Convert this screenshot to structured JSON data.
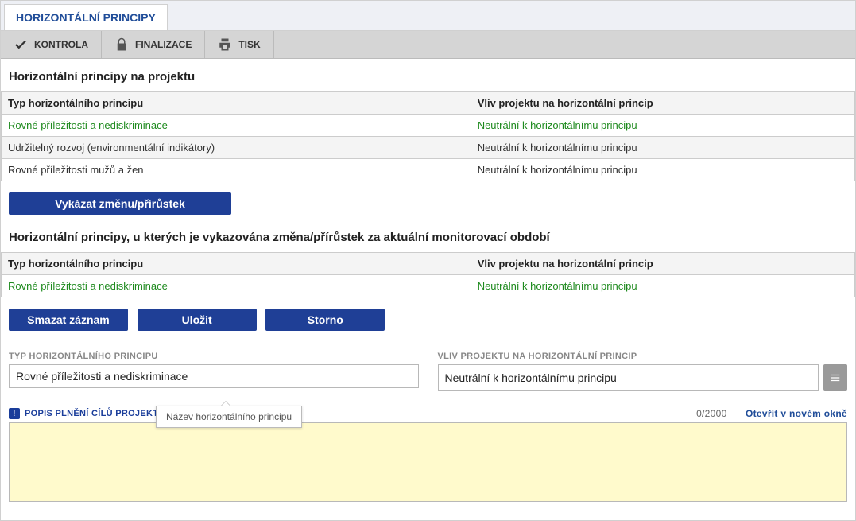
{
  "tab": "HORIZONTÁLNÍ PRINCIPY",
  "toolbar": {
    "kontrola": "KONTROLA",
    "finalizace": "FINALIZACE",
    "tisk": "TISK"
  },
  "section1_title": "Horizontální principy na projektu",
  "cols": {
    "typ": "Typ horizontálního principu",
    "vliv": "Vliv projektu na horizontální princip"
  },
  "grid1": [
    {
      "typ": "Rovné příležitosti a nediskriminace",
      "vliv": "Neutrální k horizontálnímu principu",
      "green": true
    },
    {
      "typ": "Udržitelný rozvoj (environmentální indikátory)",
      "vliv": "Neutrální k horizontálnímu principu",
      "green": false
    },
    {
      "typ": "Rovné příležitosti mužů a žen",
      "vliv": "Neutrální k horizontálnímu principu",
      "green": false
    }
  ],
  "btn_vykazat": "Vykázat změnu/přírůstek",
  "section2_title": "Horizontální principy, u kterých je vykazována změna/přírůstek za aktuální monitorovací období",
  "grid2": [
    {
      "typ": "Rovné příležitosti a nediskriminace",
      "vliv": "Neutrální k horizontálnímu principu",
      "green": true
    }
  ],
  "actions": {
    "smazat": "Smazat záznam",
    "ulozit": "Uložit",
    "storno": "Storno"
  },
  "form": {
    "typ_label": "TYP HORIZONTÁLNÍHO PRINCIPU",
    "typ_value": "Rovné příležitosti a nediskriminace",
    "vliv_label": "VLIV PROJEKTU NA HORIZONTÁLNÍ PRINCIP",
    "vliv_value": "Neutrální k horizontálnímu principu"
  },
  "desc": {
    "label": "POPIS PLNĚNÍ CÍLŮ PROJEKTU",
    "counter": "0/2000",
    "open": "Otevřít v novém okně",
    "tooltip": "Název horizontálního principu",
    "value": ""
  }
}
